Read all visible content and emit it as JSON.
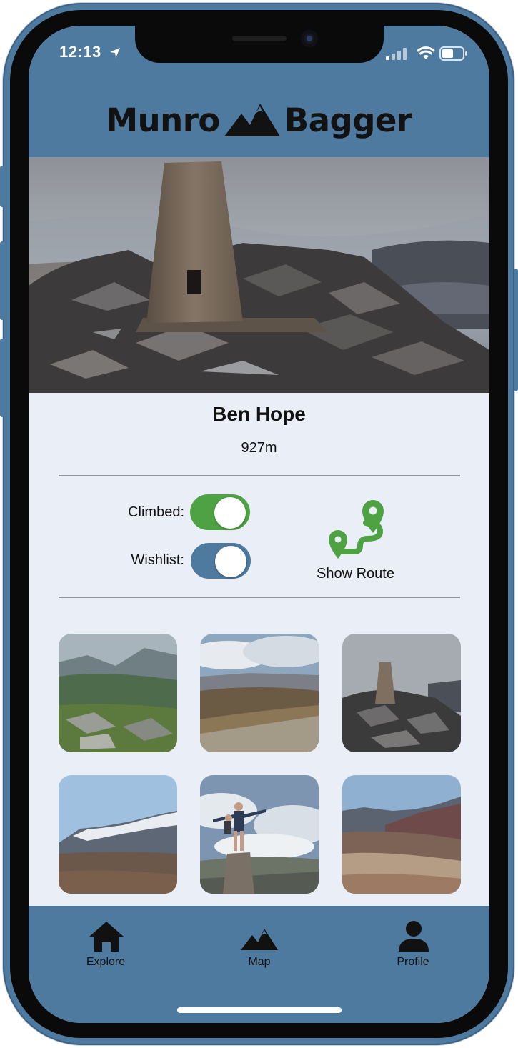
{
  "status_bar": {
    "time": "12:13"
  },
  "app": {
    "logo_word_1": "Munro",
    "logo_word_2": "Bagger"
  },
  "peak": {
    "name": "Ben Hope",
    "height": "927m"
  },
  "toggles": [
    {
      "label": "Climbed:",
      "on": true,
      "color": "#4ea244"
    },
    {
      "label": "Wishlist:",
      "on": true,
      "color": "#4e7aa0"
    }
  ],
  "route": {
    "label": "Show Route",
    "color": "#4ea244"
  },
  "gallery": [
    {
      "icon": "green-valley-photo"
    },
    {
      "icon": "cloudy-ridge-photo"
    },
    {
      "icon": "trig-point-photo"
    },
    {
      "icon": "snowy-mountain-photo"
    },
    {
      "icon": "hikers-on-trig-photo"
    },
    {
      "icon": "moorland-photo"
    }
  ],
  "tabs": [
    {
      "label": "Explore",
      "icon": "home-icon"
    },
    {
      "label": "Map",
      "icon": "mountain-icon"
    },
    {
      "label": "Profile",
      "icon": "person-icon"
    }
  ],
  "colors": {
    "accent_blue": "#4e7aa0",
    "accent_green": "#4ea244",
    "screen_bg": "#e9eef7"
  }
}
